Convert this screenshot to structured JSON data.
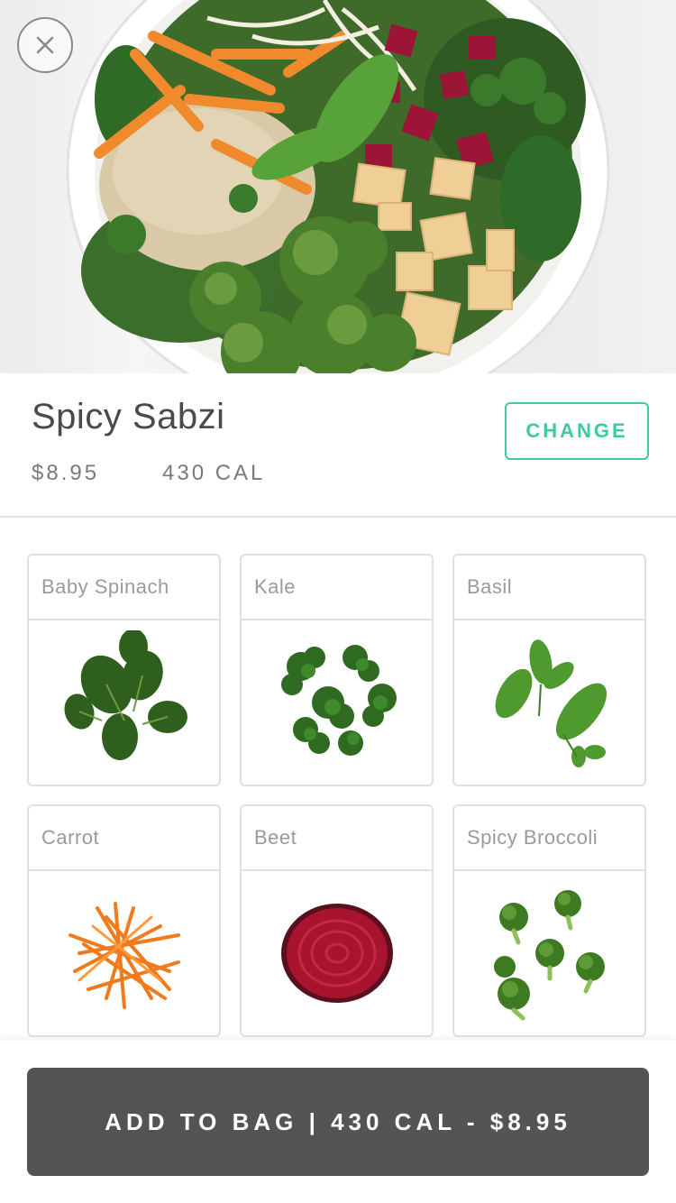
{
  "header": {
    "close_icon": "close-icon"
  },
  "item": {
    "name": "Spicy Sabzi",
    "price": "$8.95",
    "calories": "430 CAL",
    "change_label": "CHANGE"
  },
  "ingredients": [
    {
      "name": "Baby Spinach",
      "icon": "spinach-image"
    },
    {
      "name": "Kale",
      "icon": "kale-image"
    },
    {
      "name": "Basil",
      "icon": "basil-image"
    },
    {
      "name": "Carrot",
      "icon": "carrot-image"
    },
    {
      "name": "Beet",
      "icon": "beet-image"
    },
    {
      "name": "Spicy Broccoli",
      "icon": "broccoli-image"
    }
  ],
  "footer": {
    "add_to_bag_label": "ADD TO BAG | 430 CAL - $8.95"
  },
  "colors": {
    "accent": "#3fc9a3",
    "button_bg": "#545454",
    "text": "#4a4a4a"
  }
}
